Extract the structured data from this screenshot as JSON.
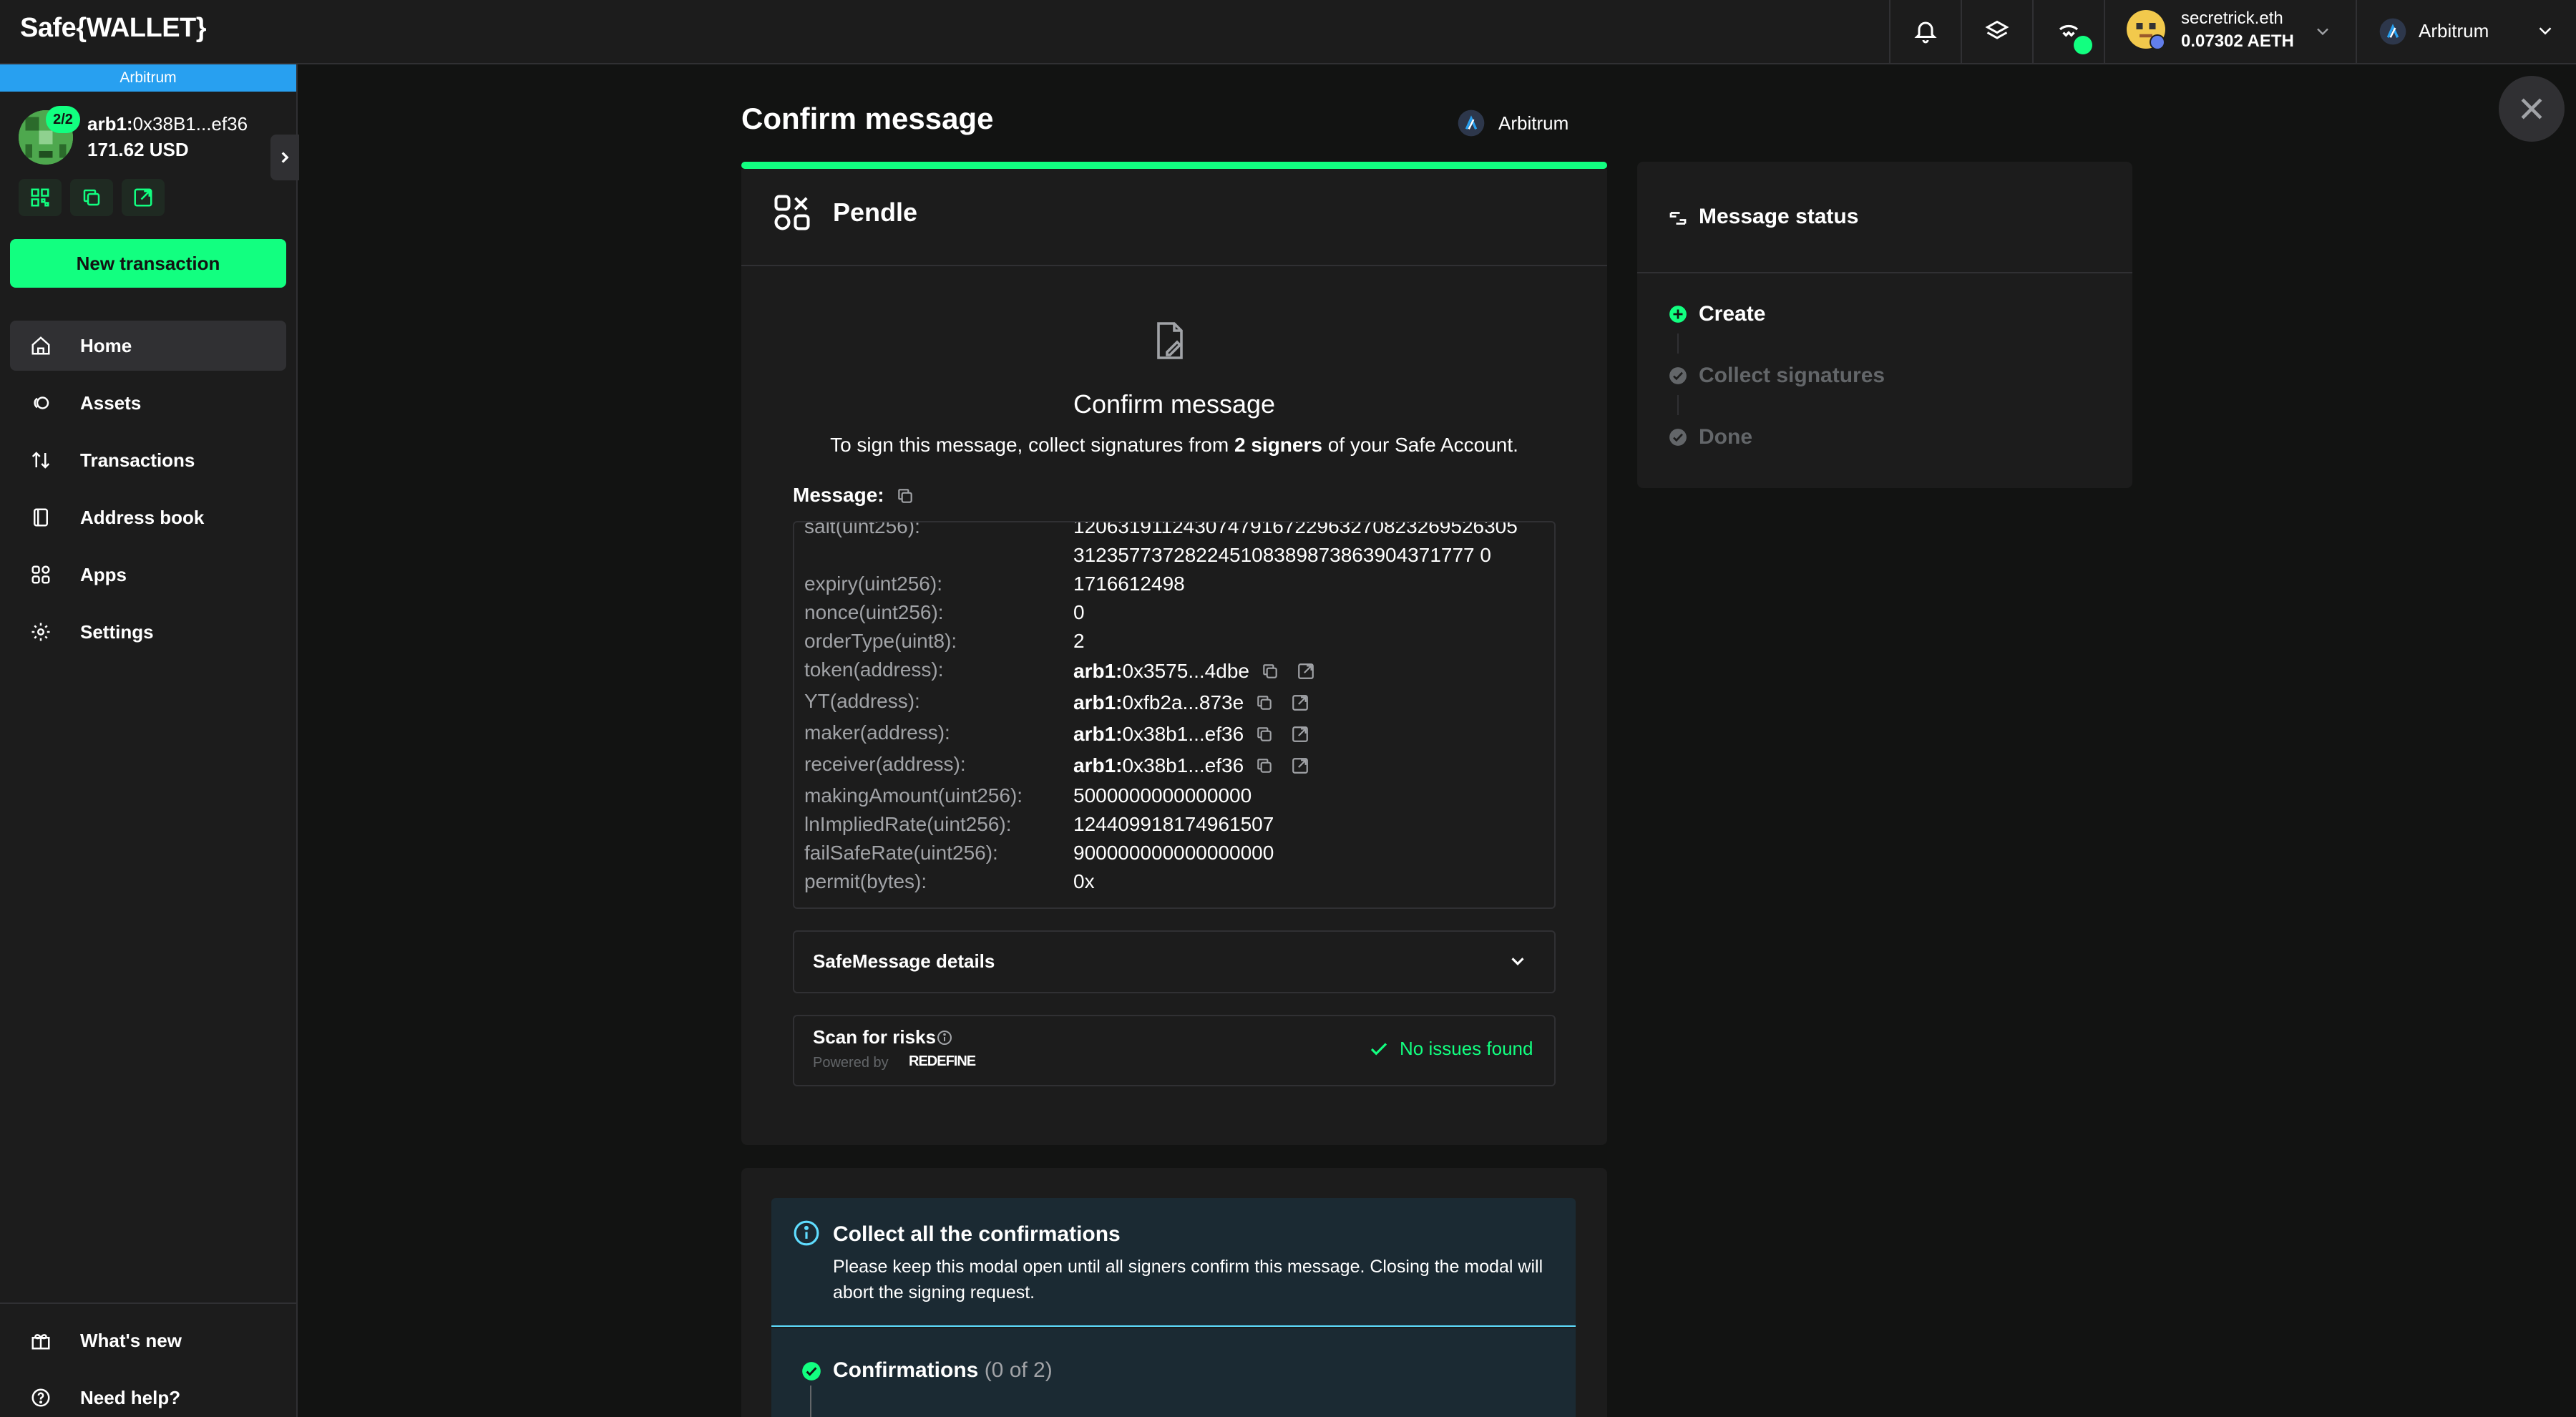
{
  "app": {
    "logo_text": "Safe{WALLET}"
  },
  "topbar": {
    "account_name": "secretrick.eth",
    "account_balance": "0.07302 AETH",
    "network": "Arbitrum",
    "icons": [
      "bell-icon",
      "layers-icon",
      "walletconnect-icon"
    ]
  },
  "sidebar": {
    "chain_label": "Arbitrum",
    "threshold": "2/2",
    "address_prefix": "arb1:",
    "address": "0x38B1...ef36",
    "balance": "171.62 USD",
    "new_transaction": "New transaction",
    "nav": [
      {
        "label": "Home",
        "icon": "home-icon"
      },
      {
        "label": "Assets",
        "icon": "assets-icon"
      },
      {
        "label": "Transactions",
        "icon": "transactions-icon"
      },
      {
        "label": "Address book",
        "icon": "address-book-icon"
      },
      {
        "label": "Apps",
        "icon": "apps-icon"
      },
      {
        "label": "Settings",
        "icon": "settings-icon"
      }
    ],
    "footer": [
      {
        "label": "What's new",
        "icon": "gift-icon"
      },
      {
        "label": "Need help?",
        "icon": "help-icon"
      }
    ]
  },
  "modal": {
    "title": "Confirm message",
    "chain": "Arbitrum",
    "progress_fraction": 1.0,
    "app_name": "Pendle",
    "heading": "Confirm message",
    "sign_prefix": "To sign this message, collect signatures from ",
    "sign_bold": "2 signers",
    "sign_suffix": " of your Safe Account.",
    "message_label": "Message:",
    "message_rows": [
      {
        "key": "salt(uint256):",
        "value": "1206319112430747916722963270823269526305"
      },
      {
        "key": "",
        "value": "312357737282245108389873863904371777 0"
      },
      {
        "key": "expiry(uint256):",
        "value": "1716612498"
      },
      {
        "key": "nonce(uint256):",
        "value": "0"
      },
      {
        "key": "orderType(uint8):",
        "value": "2"
      },
      {
        "key": "token(address):",
        "prefix": "arb1:",
        "value": "0x3575...4dbe"
      },
      {
        "key": "YT(address):",
        "prefix": "arb1:",
        "value": "0xfb2a...873e"
      },
      {
        "key": "maker(address):",
        "prefix": "arb1:",
        "value": "0x38b1...ef36"
      },
      {
        "key": "receiver(address):",
        "prefix": "arb1:",
        "value": "0x38b1...ef36"
      },
      {
        "key": "makingAmount(uint256):",
        "value": "5000000000000000"
      },
      {
        "key": "lnImpliedRate(uint256):",
        "value": "124409918174961507"
      },
      {
        "key": "failSafeRate(uint256):",
        "value": "900000000000000000"
      },
      {
        "key": "permit(bytes):",
        "value": "0x"
      }
    ],
    "details_label": "SafeMessage details",
    "scan_label": "Scan for risks",
    "scan_powered": "Powered by",
    "scan_brand": "REDEFINE",
    "scan_result": "No issues found"
  },
  "confirmations": {
    "info_title": "Collect all the confirmations",
    "info_text": "Please keep this modal open until all signers confirm this message. Closing the modal will abort the signing request.",
    "label": "Confirmations",
    "count": "(0 of 2)"
  },
  "status": {
    "title": "Message status",
    "steps": [
      {
        "label": "Create",
        "state": "active"
      },
      {
        "label": "Collect signatures",
        "state": "pending"
      },
      {
        "label": "Done",
        "state": "pending"
      }
    ]
  },
  "colors": {
    "accent": "#12ff80",
    "background": "#121312",
    "panel": "#1c1c1c",
    "border": "#303033",
    "info": "#5fddff",
    "arbitrum": "#28a0f0"
  }
}
